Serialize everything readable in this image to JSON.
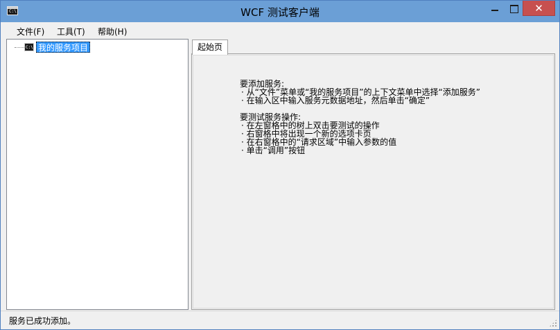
{
  "window": {
    "title": "WCF 测试客户端",
    "icon_label": "C:\\",
    "close_glyph": "✕"
  },
  "menu": {
    "items": [
      "文件(F)",
      "工具(T)",
      "帮助(H)"
    ]
  },
  "tree": {
    "root_label": "我的服务项目",
    "node_icon_label": "C:\\"
  },
  "tabs": {
    "active_label": "起始页"
  },
  "start_page": {
    "add_heading": "要添加服务:",
    "add_steps": [
      "·  从“文件”菜单或“我的服务项目”的上下文菜单中选择“添加服务”",
      "·  在输入区中输入服务元数据地址，然后单击“确定”"
    ],
    "test_heading": "要测试服务操作:",
    "test_steps": [
      "·  在左窗格中的树上双击要测试的操作",
      "·  右窗格中将出现一个新的选项卡页",
      "·  在右窗格中的“请求区域”中输入参数的值",
      "·  单击“调用”按钮"
    ]
  },
  "status": {
    "text": "服务已成功添加。"
  },
  "icons": {
    "app": "console-app-icon",
    "minimize": "minimize-icon",
    "maximize": "maximize-icon",
    "close": "close-icon",
    "tree_node": "console-service-icon",
    "grip": "resize-grip-icon"
  },
  "colors": {
    "titlebar": "#6b9fd6",
    "close_button": "#c7504f",
    "selection": "#3399ff"
  }
}
